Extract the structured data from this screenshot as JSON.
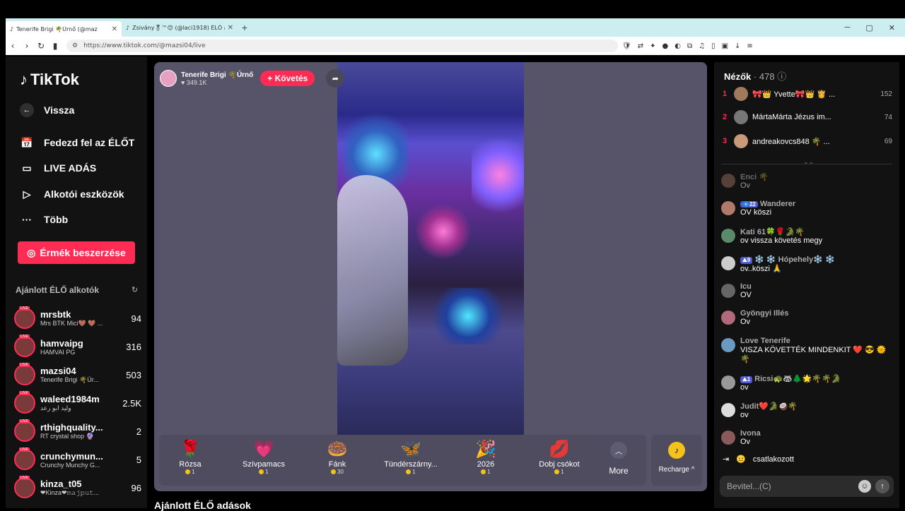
{
  "browser": {
    "tabs": [
      {
        "title": "Tenerife Brigi 🌴Úrnő (@maz",
        "active": true
      },
      {
        "title": "Zsivány🎖™😊 (@laci1918) ÉLŐ adás",
        "active": false
      }
    ],
    "url": "https://www.tiktok.com/@mazsi04/live"
  },
  "sidebar": {
    "logo": "TikTok",
    "nav": [
      {
        "label": "Vissza",
        "icon": "back-arrow-icon"
      },
      {
        "label": "Fedezd fel az ÉLŐT",
        "icon": "explore-live-icon"
      },
      {
        "label": "LIVE ADÁS",
        "icon": "camera-icon"
      },
      {
        "label": "Alkotói eszközök",
        "icon": "creator-tools-icon"
      },
      {
        "label": "Több",
        "icon": "more-dots-icon"
      }
    ],
    "coins_button": "Érmék beszerzése",
    "section_title": "Ajánlott ÉLŐ alkotók",
    "creators": [
      {
        "name": "mrsbtk",
        "sub": "Mrs BTK Mici🤎 🤎 ...",
        "count": "94"
      },
      {
        "name": "hamvaipg",
        "sub": "HAMVAI PG",
        "count": "316"
      },
      {
        "name": "mazsi04",
        "sub": "Tenerife Brigi 🌴Úr...",
        "count": "503"
      },
      {
        "name": "waleed1984m",
        "sub": "وليد ابو رعد",
        "count": "2.5K"
      },
      {
        "name": "rthighquality...",
        "sub": "RT crystal shop 🔮",
        "count": "2"
      },
      {
        "name": "crunchymun...",
        "sub": "Crunchy Munchy G...",
        "count": "5"
      },
      {
        "name": "kinza_t05",
        "sub": "❤Kinza❤𝚖𝚊𝚓𝚙𝚞𝚝...",
        "count": "96"
      }
    ]
  },
  "stream": {
    "host_name": "Tenerife Brigi 🌴Úrnő",
    "host_likes": "349.1K",
    "follow_label": "+ Követés",
    "gifts": [
      {
        "name": "Rózsa",
        "price": "1",
        "icon": "🌹"
      },
      {
        "name": "Szívpamacs",
        "price": "1",
        "icon": "💗"
      },
      {
        "name": "Fánk",
        "price": "30",
        "icon": "🍩"
      },
      {
        "name": "Tündérszárny...",
        "price": "1",
        "icon": "🦋"
      },
      {
        "name": "2026",
        "price": "1",
        "icon": "🎉"
      },
      {
        "name": "Dobj csókot",
        "price": "1",
        "icon": "💋"
      }
    ],
    "more_label": "More",
    "recharge_label": "Recharge ^",
    "bottom_title": "Ajánlott ÉLŐ adások"
  },
  "panel": {
    "viewers_label": "Nézők",
    "viewers_count": "· 478",
    "ranking": [
      {
        "rank": "1",
        "name": "🎀👑 Yvette🎀👑 👸 ...",
        "score": "152"
      },
      {
        "rank": "2",
        "name": "MártaMárta Jézus im...",
        "score": "74"
      },
      {
        "rank": "3",
        "name": "andreakovcs848 🌴 ...",
        "score": "69"
      }
    ],
    "chat": [
      {
        "user": "Enci 🌴",
        "msg": "Ov",
        "badge": ""
      },
      {
        "user": "Wanderer",
        "msg": "OV köszi",
        "badge": "💠22"
      },
      {
        "user": "Kati 61🍀🌹🐊🌴",
        "msg": "ov vissza követés megy",
        "badge": ""
      },
      {
        "user": "❄️ ❄️ Hópehely❄️ ❄️",
        "msg": "ov..köszi 🙏",
        "badge": "⛰9"
      },
      {
        "user": "Icu",
        "msg": "OV",
        "badge": ""
      },
      {
        "user": "Gyöngyi Illés",
        "msg": "Ov",
        "badge": ""
      },
      {
        "user": "Love Tenerife",
        "msg": "VISZA KÖVETTÉK MINDENKIT ❤️ 😎 🌞 🌴",
        "badge": ""
      },
      {
        "user": "Ricsi🐢🦝🌲🌟🌴🌴🐊",
        "msg": "ov",
        "badge": "⛰1"
      },
      {
        "user": "Judit❤️🐊🥥🌴",
        "msg": "ov",
        "badge": ""
      },
      {
        "user": "Ivona",
        "msg": "Ov",
        "badge": ""
      }
    ],
    "joined_text": "csatlakozott",
    "input_placeholder": "Bevitel...(C)"
  }
}
